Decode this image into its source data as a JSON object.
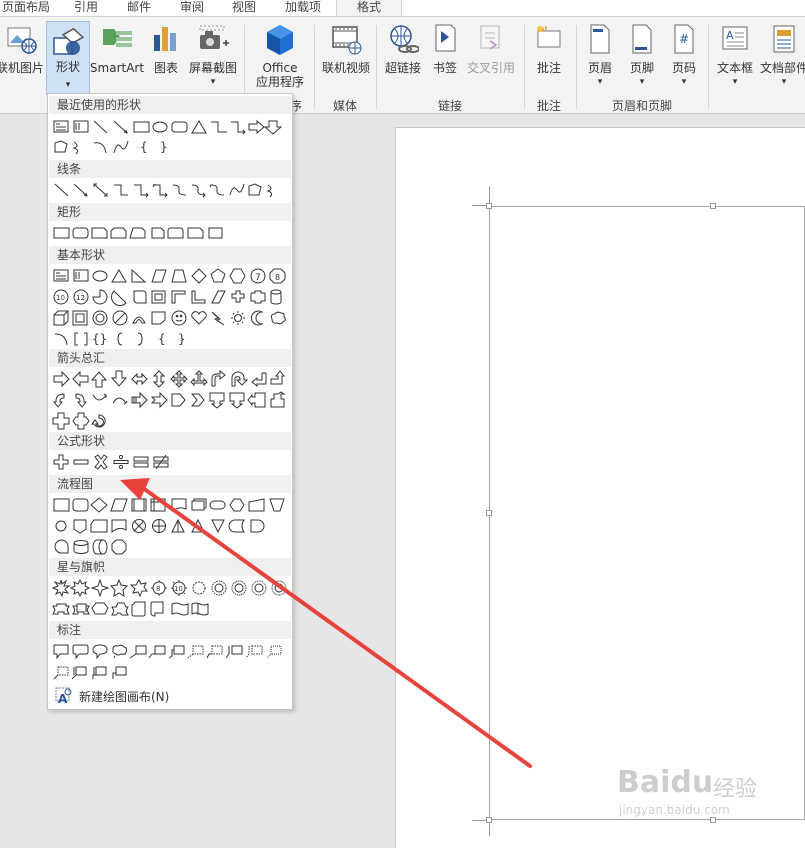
{
  "tabs": [
    "页面布局",
    "引用",
    "邮件",
    "审阅",
    "视图",
    "加载项",
    "格式"
  ],
  "ribbon": {
    "buttons": {
      "online_picture": "联机图片",
      "shapes": "形状",
      "smartart": "SmartArt",
      "chart": "图表",
      "screenshot": "屏幕截图",
      "office_apps_1": "Office",
      "office_apps_2": "应用程序",
      "online_video": "联机视频",
      "hyperlink": "超链接",
      "bookmark": "书签",
      "cross_ref": "交叉引用",
      "comment": "批注",
      "header": "页眉",
      "footer": "页脚",
      "page_number": "页码",
      "textbox": "文本框",
      "doc_parts": "文档部件"
    },
    "groups": {
      "apps_tail": "序",
      "media": "媒体",
      "links": "链接",
      "comments": "批注",
      "header_footer": "页眉和页脚"
    }
  },
  "shapes_menu": {
    "sections": {
      "recent": "最近使用的形状",
      "lines": "线条",
      "rectangles": "矩形",
      "basic": "基本形状",
      "arrows": "箭头总汇",
      "equation": "公式形状",
      "flowchart": "流程图",
      "stars": "星与旗帜",
      "callouts": "标注"
    },
    "new_canvas": "新建绘图画布(N)"
  },
  "watermark": {
    "logo": "Baidu",
    "text": "经验",
    "url": "jingyan.baidu.com"
  },
  "colors": {
    "accent": "#2b579a",
    "arrow": "#e8423c",
    "highlight": "#cfe2f4"
  }
}
